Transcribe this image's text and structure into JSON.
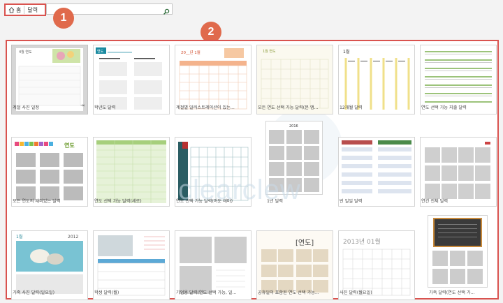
{
  "breadcrumb": {
    "home_label": "홈",
    "current": "달력"
  },
  "search": {
    "value": "",
    "placeholder": ""
  },
  "badges": {
    "first": "1",
    "second": "2"
  },
  "watermark": "clearclew",
  "tiles": [
    {
      "caption": "계절 사진 일정",
      "header": "4월 연도"
    },
    {
      "caption": "학년도 달력",
      "header": "연도"
    },
    {
      "caption": "계절별 일러스트레이션이 있는...",
      "header": "20__년 1월"
    },
    {
      "caption": "모든 연도 선택 가능 달력(문 앱...",
      "header": "1월 연도"
    },
    {
      "caption": "12개월 달력",
      "header": "1월"
    },
    {
      "caption": "연도 선택 가능 지출 달력",
      "header": ""
    },
    {
      "caption": "모든 연도의 재미있는 달력",
      "header": "연도"
    },
    {
      "caption": "연도 선택 가능 달력(세로)",
      "header": ""
    },
    {
      "caption": "연도 선택 가능 달력(어둔 테마)",
      "header": ""
    },
    {
      "caption": "1년 달력",
      "header": "2016"
    },
    {
      "caption": "빈 일일 달력",
      "header": ""
    },
    {
      "caption": "연간 전체 달력",
      "header": ""
    },
    {
      "caption": "가족 사진 달력(일요일)",
      "header": "1월",
      "year": "2012"
    },
    {
      "caption": "학생 달력(월)",
      "header": ""
    },
    {
      "caption": "기업용 달력(연도 선택 가능, 일...",
      "header": ""
    },
    {
      "caption": "공휴일이 포함된 연도 선택 가능...",
      "header": "[연도]"
    },
    {
      "caption": "사진 달력(월요일)",
      "header": "2013년 01월"
    },
    {
      "caption": "가족 달력(연도 선택 가...",
      "header": ""
    }
  ],
  "colors": {
    "accent": "#d9534f",
    "badge": "#e06a4c"
  }
}
